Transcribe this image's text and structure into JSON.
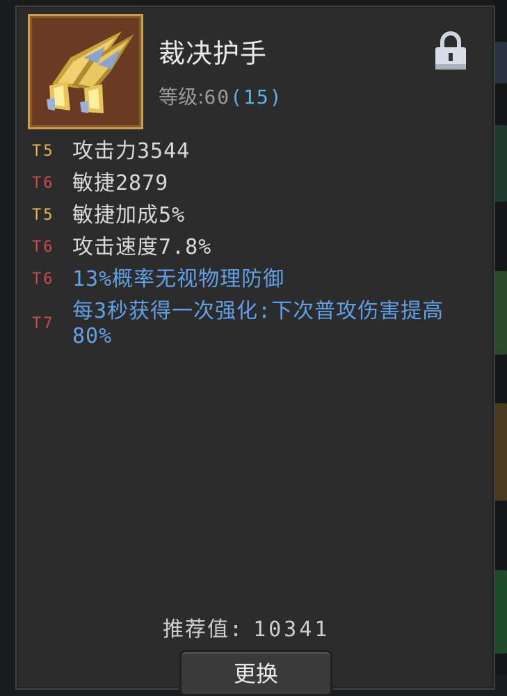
{
  "item": {
    "name": "裁决护手",
    "level_label": "等级:",
    "level_value": "60",
    "level_extra": "(15)",
    "icon": "gauntlets-icon",
    "locked": true
  },
  "attributes": [
    {
      "tier": "T5",
      "text": "攻击力3544",
      "style": "normal"
    },
    {
      "tier": "T6",
      "text": "敏捷2879",
      "style": "normal"
    },
    {
      "tier": "T5",
      "text": "敏捷加成5%",
      "style": "normal"
    },
    {
      "tier": "T6",
      "text": "攻击速度7.8%",
      "style": "normal"
    },
    {
      "tier": "T6",
      "text": "13%概率无视物理防御",
      "style": "blue"
    },
    {
      "tier": "T7",
      "text": "每3秒获得一次强化:下次普攻伤害提高80%",
      "style": "blue"
    }
  ],
  "recommend": {
    "label": "推荐值:",
    "value": "10341"
  },
  "actions": {
    "replace_label": "更换"
  },
  "colors": {
    "panel": "#2c2c2c",
    "tier_gold": "#e6b84a",
    "tier_red": "#d04848",
    "special_blue": "#5fa0e6",
    "level_blue": "#58b4e6"
  }
}
